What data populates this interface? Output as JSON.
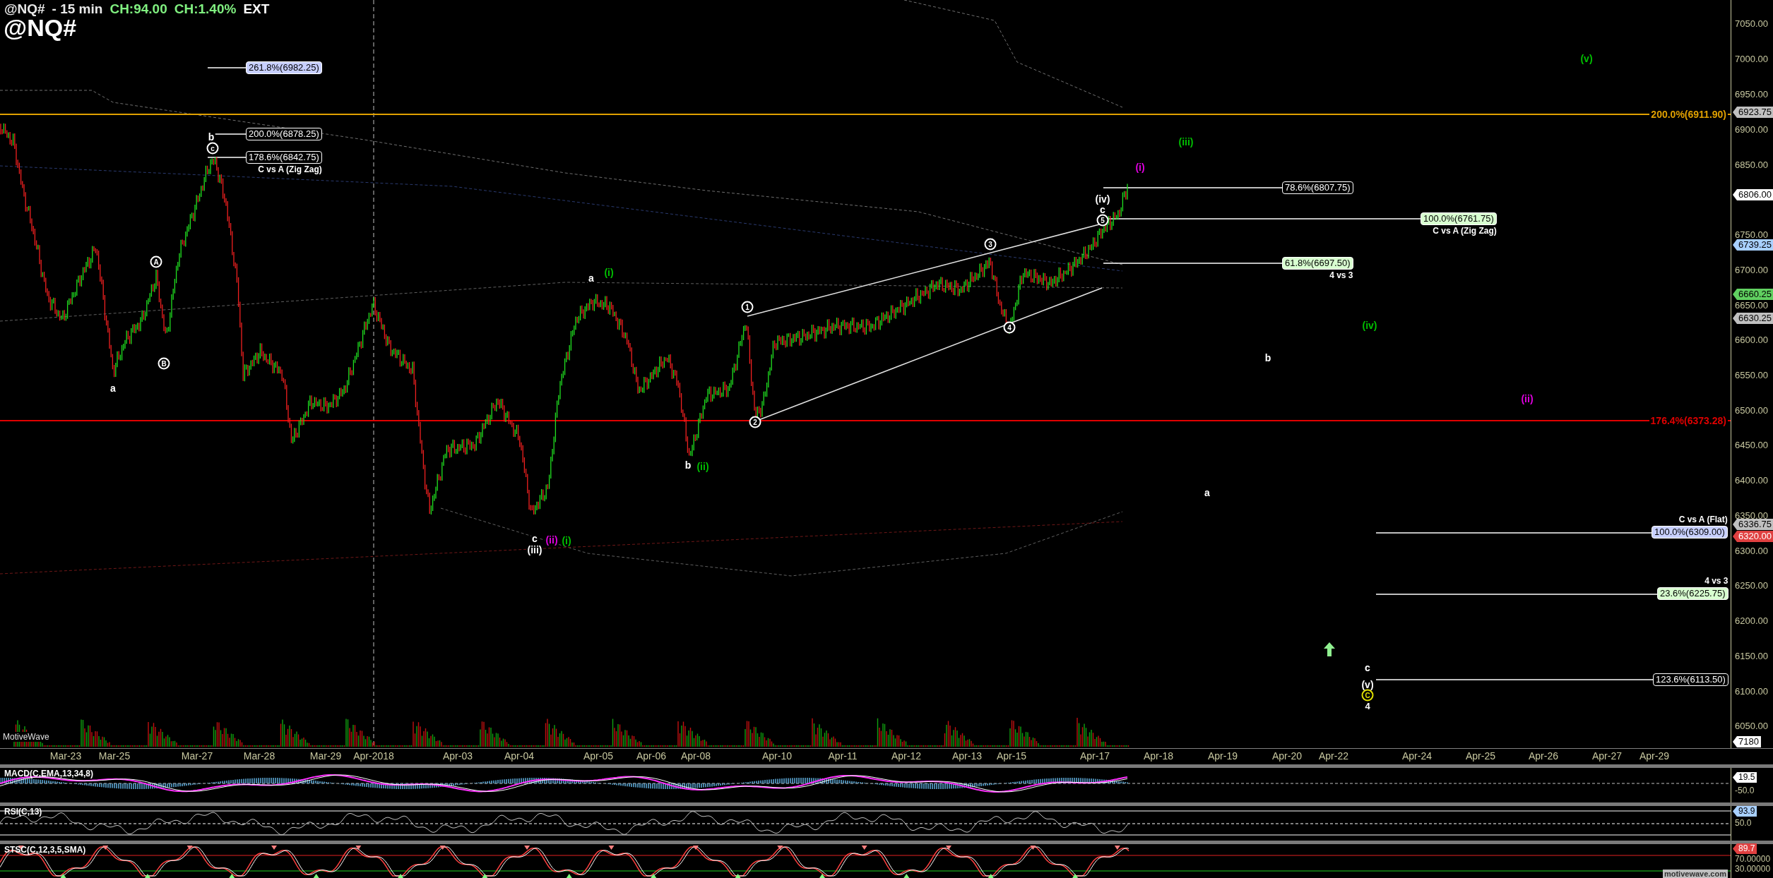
{
  "header": {
    "symbol": "@NQ#",
    "interval": "- 15 min",
    "stats": [
      "CH:94.00",
      "CH:1.40%"
    ],
    "session": "EXT",
    "big_symbol": "@NQ#"
  },
  "chart": {
    "level_lines": [
      {
        "label": "200.0%(6911.90)",
        "color": "#e0a000"
      },
      {
        "label": "176.4%(6373.28)",
        "color": "#e00000"
      }
    ],
    "fib_levels": [
      {
        "label": "261.8%(6982.25)",
        "color": "#c8d0ff"
      },
      {
        "label": "200.0%(6878.25)",
        "color": "#000000"
      },
      {
        "label": "178.6%(6842.75)",
        "color": "#000000",
        "note": "C vs A (Zig Zag)"
      },
      {
        "label": "78.6%(6807.75)",
        "color": "#000000"
      },
      {
        "label": "100.0%(6761.75)",
        "color": "#d8ffd0",
        "note": "C vs A (Zig Zag)"
      },
      {
        "label": "61.8%(6697.50)",
        "color": "#d8ffd0",
        "note": "4 vs 3"
      },
      {
        "label": "100.0%(6309.00)",
        "color": "#c8d0ff",
        "note": "C vs A (Flat)"
      },
      {
        "label": "23.6%(6225.75)",
        "color": "#d8ffd0",
        "note": "4 vs 3"
      },
      {
        "label": "123.6%(6113.50)",
        "color": "#000000"
      }
    ],
    "wave_labels": [
      {
        "text": "a",
        "kind": "plain",
        "color": "#ffffff"
      },
      {
        "text": "A",
        "kind": "circled",
        "color": "#ffffff"
      },
      {
        "text": "B",
        "kind": "circled",
        "color": "#ffffff"
      },
      {
        "text": "b",
        "kind": "plain",
        "color": "#ffffff"
      },
      {
        "text": "c",
        "kind": "circled",
        "color": "#ffffff"
      },
      {
        "text": "a",
        "kind": "plain",
        "color": "#ffffff"
      },
      {
        "text": "(i)",
        "kind": "plain",
        "color": "#00c000"
      },
      {
        "text": "b",
        "kind": "plain",
        "color": "#ffffff"
      },
      {
        "text": "(ii)",
        "kind": "plain",
        "color": "#00c000"
      },
      {
        "text": "c",
        "kind": "plain",
        "color": "#ffffff"
      },
      {
        "text": "(iii)",
        "kind": "plain",
        "color": "#ffffff"
      },
      {
        "text": "(ii)",
        "kind": "plain",
        "color": "#e000e0"
      },
      {
        "text": "(i)",
        "kind": "plain",
        "color": "#00c000"
      },
      {
        "text": "1",
        "kind": "circled",
        "color": "#ffffff"
      },
      {
        "text": "2",
        "kind": "circled",
        "color": "#ffffff"
      },
      {
        "text": "3",
        "kind": "circled",
        "color": "#ffffff"
      },
      {
        "text": "4",
        "kind": "circled",
        "color": "#ffffff"
      },
      {
        "text": "(iv)",
        "kind": "plain",
        "color": "#ffffff"
      },
      {
        "text": "c",
        "kind": "plain",
        "color": "#ffffff"
      },
      {
        "text": "5",
        "kind": "circled",
        "color": "#ffffff"
      },
      {
        "text": "(i)",
        "kind": "plain",
        "color": "#e000e0"
      },
      {
        "text": "(iii)",
        "kind": "plain",
        "color": "#00c000"
      },
      {
        "text": "b",
        "kind": "plain",
        "color": "#ffffff"
      },
      {
        "text": "(v)",
        "kind": "plain",
        "color": "#00c000"
      },
      {
        "text": "(iv)",
        "kind": "plain",
        "color": "#00c000"
      },
      {
        "text": "(ii)",
        "kind": "plain",
        "color": "#e000e0"
      },
      {
        "text": "a",
        "kind": "plain",
        "color": "#ffffff"
      },
      {
        "text": "c",
        "kind": "plain",
        "color": "#ffffff"
      },
      {
        "text": "(v)",
        "kind": "plain",
        "color": "#ffffff"
      },
      {
        "text": "C",
        "kind": "circled",
        "color": "#e0e000"
      },
      {
        "text": "4",
        "kind": "bold",
        "color": "#ffffff"
      }
    ],
    "volume_label": "MotiveWave",
    "price_ticks": [
      "7050.00",
      "7000.00",
      "6950.00",
      "6900.00",
      "6850.00",
      "6750.00",
      "6700.00",
      "6650.00",
      "6600.00",
      "6550.00",
      "6500.00",
      "6450.00",
      "6400.00",
      "6350.00",
      "6300.00",
      "6250.00",
      "6200.00",
      "6150.00",
      "6100.00",
      "6050.00"
    ],
    "price_tags": [
      {
        "text": "6923.75",
        "color": "#c0c0c0"
      },
      {
        "text": "6806.00",
        "color": "#ffffff"
      },
      {
        "text": "6739.25",
        "color": "#a8d0ff"
      },
      {
        "text": "6660.25",
        "color": "#60d060"
      },
      {
        "text": "6630.25",
        "color": "#c0c0c0"
      },
      {
        "text": "6336.75",
        "color": "#c0c0c0"
      },
      {
        "text": "6320.00",
        "color": "#e04040"
      },
      {
        "text": "7180",
        "color": "#ffffff"
      }
    ],
    "dates": [
      "Mar-23",
      "Mar-25",
      "Mar-27",
      "Mar-28",
      "Mar-29",
      "Apr-2018",
      "Apr-03",
      "Apr-04",
      "Apr-05",
      "Apr-06",
      "Apr-08",
      "Apr-10",
      "Apr-11",
      "Apr-12",
      "Apr-13",
      "Apr-15",
      "Apr-17",
      "Apr-18",
      "Apr-19",
      "Apr-20",
      "Apr-22",
      "Apr-24",
      "Apr-25",
      "Apr-26",
      "Apr-27",
      "Apr-29"
    ]
  },
  "indicators": [
    {
      "title": "MACD(C,EMA,13,34,8)",
      "kind": "macd",
      "tag": {
        "text": "19.5",
        "color": "#ffffff"
      },
      "ticks": [
        "-50.0"
      ]
    },
    {
      "title": "RSI(C,13)",
      "kind": "rsi",
      "tag": {
        "text": "93.9",
        "color": "#a8d0ff"
      },
      "ticks": [
        "50.0"
      ]
    },
    {
      "title": "STSC(C,12,3,5,SMA)",
      "kind": "stsc",
      "tag": {
        "text": "89.7",
        "color": "#e04040"
      },
      "ticks": [
        "70.00000",
        "30.00000"
      ]
    }
  ],
  "footer": "motivewave.com"
}
